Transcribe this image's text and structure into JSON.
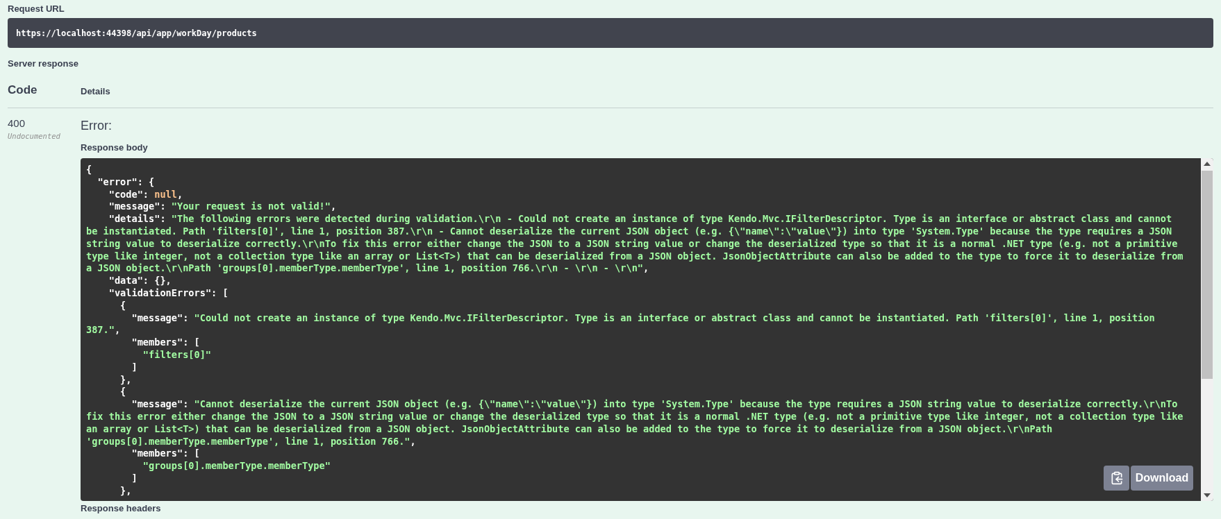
{
  "request_url": {
    "label": "Request URL",
    "url": "https://localhost:44398/api/app/workDay/products"
  },
  "server_response": {
    "title": "Server response",
    "columns": [
      "Code",
      "Details"
    ],
    "response": {
      "code": "400",
      "code_note": "Undocumented",
      "status": "Error:",
      "body_label": "Response body",
      "body_lines": [
        "{",
        "  \"error\": {",
        "    \"code\": null,",
        "    \"message\": \"Your request is not valid!\",",
        "    \"details\": \"The following errors were detected during validation.\\r\\n - Could not create an instance of type Kendo.Mvc.IFilterDescriptor. Type is an interface or abstract class and cannot be instantiated. Path 'filters[0]', line 1, position 387.\\r\\n - Cannot deserialize the current JSON object (e.g. {\\\"name\\\":\\\"value\\\"}) into type 'System.Type' because the type requires a JSON string value to deserialize correctly.\\r\\nTo fix this error either change the JSON to a JSON string value or change the deserialized type so that it is a normal .NET type (e.g. not a primitive type like integer, not a collection type like an array or List<T>) that can be deserialized from a JSON object. JsonObjectAttribute can also be added to the type to force it to deserialize from a JSON object.\\r\\nPath 'groups[0].memberType.memberType', line 1, position 766.\\r\\n - \\r\\n - \\r\\n\",",
        "    \"data\": {},",
        "    \"validationErrors\": [",
        "      {",
        "        \"message\": \"Could not create an instance of type Kendo.Mvc.IFilterDescriptor. Type is an interface or abstract class and cannot be instantiated. Path 'filters[0]', line 1, position 387.\",",
        "        \"members\": [",
        "          \"filters[0]\"",
        "        ]",
        "      },",
        "      {",
        "        \"message\": \"Cannot deserialize the current JSON object (e.g. {\\\"name\\\":\\\"value\\\"}) into type 'System.Type' because the type requires a JSON string value to deserialize correctly.\\r\\nTo fix this error either change the JSON to a JSON string value or change the deserialized type so that it is a normal .NET type (e.g. not a primitive type like integer, not a collection type like an array or List<T>) that can be deserialized from a JSON object. JsonObjectAttribute can also be added to the type to force it to deserialize from a JSON object.\\r\\nPath 'groups[0].memberType.memberType', line 1, position 766.\",",
        "        \"members\": [",
        "          \"groups[0].memberType.memberType\"",
        "        ]",
        "      },"
      ],
      "download_button": "Download"
    }
  },
  "response_headers_label": "Response headers"
}
